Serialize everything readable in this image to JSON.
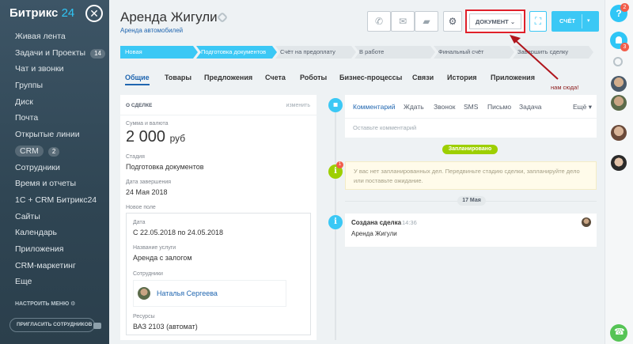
{
  "sidebar": {
    "logo_text": "Битрикс",
    "logo_num": "24",
    "items": [
      {
        "label": "Живая лента",
        "count": ""
      },
      {
        "label": "Задачи и Проекты",
        "count": "14"
      },
      {
        "label": "Чат и звонки",
        "count": ""
      },
      {
        "label": "Группы",
        "count": ""
      },
      {
        "label": "Диск",
        "count": ""
      },
      {
        "label": "Почта",
        "count": ""
      },
      {
        "label": "Открытые линии",
        "count": ""
      },
      {
        "label": "CRM",
        "count": "2"
      },
      {
        "label": "Сотрудники",
        "count": ""
      },
      {
        "label": "Время и отчеты",
        "count": ""
      },
      {
        "label": "1С + CRM Битрикс24",
        "count": ""
      },
      {
        "label": "Сайты",
        "count": ""
      },
      {
        "label": "Календарь",
        "count": ""
      },
      {
        "label": "Приложения",
        "count": ""
      },
      {
        "label": "CRM-маркетинг",
        "count": ""
      },
      {
        "label": "Еще",
        "count": ""
      }
    ],
    "settings_label": "НАСТРОИТЬ МЕНЮ",
    "invite_label": "ПРИГЛАСИТЬ СОТРУДНИКОВ"
  },
  "rightbar": {
    "help_badge": "2",
    "notify_badge": "3"
  },
  "header": {
    "title": "Аренда Жигули",
    "subtitle": "Аренда автомобилей",
    "document_label": "ДОКУМЕНТ",
    "score_label": "СЧЁТ"
  },
  "stages": [
    "Новая",
    "Подготовка документов",
    "Счёт на предоплату",
    "В работе",
    "Финальный счёт",
    "Завершить сделку"
  ],
  "tabs": [
    "Общие",
    "Товары",
    "Предложения",
    "Счета",
    "Роботы",
    "Бизнес-процессы",
    "Связи",
    "История",
    "Приложения"
  ],
  "annotation": "нам сюда!",
  "deal": {
    "heading": "О СДЕЛКЕ",
    "edit_label": "изменить",
    "amount_label": "Сумма и валюта",
    "amount_value": "2 000",
    "amount_currency": "руб",
    "stage_label": "Стадия",
    "stage_value": "Подготовка документов",
    "end_date_label": "Дата завершения",
    "end_date_value": "24 Мая 2018",
    "new_field_label": "Новое поле",
    "date_label": "Дата",
    "date_value": "С 22.05.2018 по 24.05.2018",
    "service_label": "Название услуги",
    "service_value": "Аренда с залогом",
    "staff_label": "Сотрудники",
    "staff_name": "Наталья Сергеева",
    "resources_label": "Ресурсы",
    "resources_value": "ВАЗ 2103 (автомат)"
  },
  "timeline": {
    "editor_tabs": [
      "Комментарий",
      "Ждать",
      "Звонок",
      "SMS",
      "Письмо",
      "Задача"
    ],
    "more_label": "Ещё",
    "placeholder": "Оставьте комментарий",
    "planned_label": "Запланировано",
    "warning_text": "У вас нет запланированных дел. Передвиньте стадию сделки, запланируйте дело или поставьте ожидание.",
    "warning_badge": "1",
    "date_badge": "17 Мая",
    "event_title": "Создана сделка",
    "event_time": "14:36",
    "event_text": "Аренда Жигули"
  },
  "colors": {
    "accent": "#3bc8f5",
    "link": "#2066b0",
    "highlight": "#e0202a",
    "planned": "#9dcf00"
  }
}
